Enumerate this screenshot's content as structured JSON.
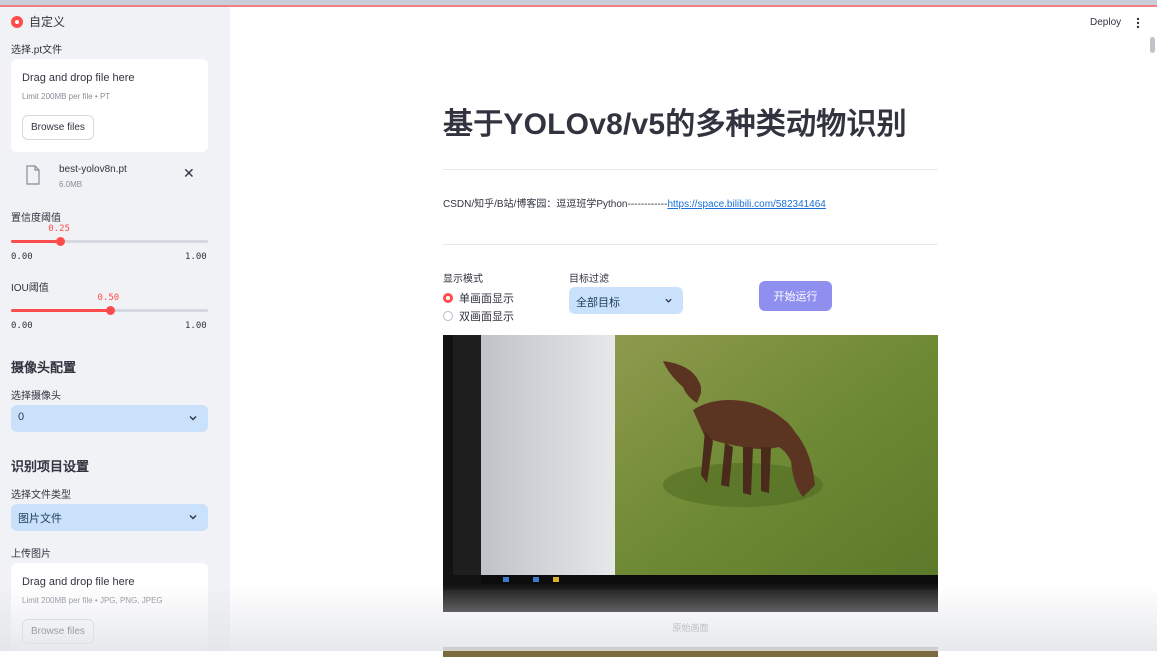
{
  "sidebar": {
    "header": "自定义",
    "model_section": {
      "label": "选择.pt文件",
      "dropzone_title": "Drag and drop file here",
      "dropzone_limit": "Limit 200MB per file • PT",
      "browse_label": "Browse files",
      "file_name": "best-yolov8n.pt",
      "file_size": "6.0MB"
    },
    "confidence": {
      "label": "置信度阈值",
      "value": 0.25,
      "value_text": "0.25",
      "min_text": "0.00",
      "max_text": "1.00",
      "fraction": 0.25
    },
    "iou": {
      "label": "IOU阈值",
      "value": 0.5,
      "value_text": "0.50",
      "min_text": "0.00",
      "max_text": "1.00",
      "fraction": 0.5
    },
    "camera_section": {
      "heading": "摄像头配置",
      "label": "选择摄像头",
      "value": "0"
    },
    "detect_section": {
      "heading": "识别项目设置",
      "filetype_label": "选择文件类型",
      "filetype_value": "图片文件",
      "upload_label": "上传图片",
      "dropzone_title": "Drag and drop file here",
      "dropzone_limit": "Limit 200MB per file • JPG, PNG, JPEG",
      "browse_label": "Browse files"
    }
  },
  "toolbar": {
    "deploy_label": "Deploy"
  },
  "main": {
    "title": "基于YOLOv8/v5的多种类动物识别",
    "info_prefix": "CSDN/知乎/B站/博客园：逗逗班学Python------------",
    "info_link": "https://space.bilibili.com/582341464",
    "display_mode": {
      "label": "显示模式",
      "options": [
        "单画面显示",
        "双画面显示"
      ],
      "selected": 0
    },
    "target_filter": {
      "label": "目标过滤",
      "value": "全部目标"
    },
    "run_button": "开始运行",
    "image_caption": "原始画面"
  },
  "colors": {
    "accent": "#ff4b4b",
    "select_bg": "#c9e1fb",
    "run_button": "#8f8ff0",
    "link": "#1a6ed8"
  }
}
